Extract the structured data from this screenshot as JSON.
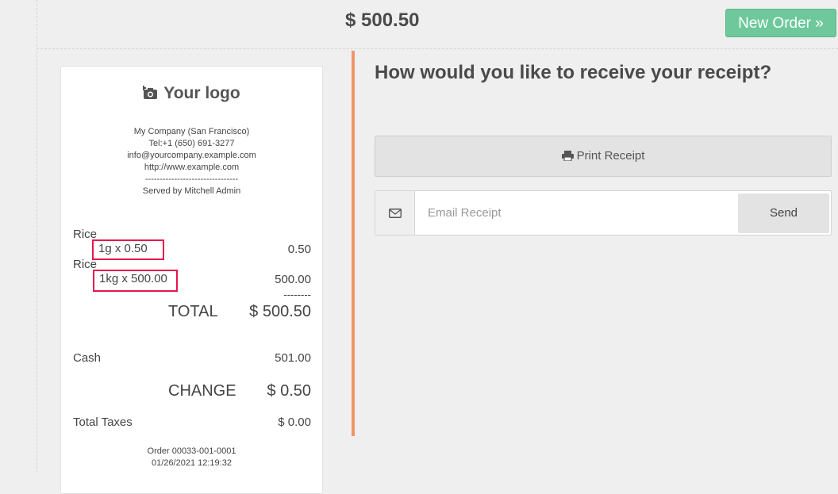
{
  "header": {
    "total": "$ 500.50",
    "new_order_label": "New Order",
    "new_order_icon": "double-chevron-right-icon"
  },
  "receipt": {
    "logo_text": "Your logo",
    "company_lines": [
      "My Company (San Francisco)",
      "Tel:+1 (650) 691-3277",
      "info@yourcompany.example.com",
      "http://www.example.com",
      "--------------------------------",
      "Served by Mitchell Admin"
    ],
    "lines": [
      {
        "product": "Rice",
        "qty": "1g x 0.50",
        "amount": "0.50"
      },
      {
        "product": "Rice",
        "qty": "1kg x 500.00",
        "amount": "500.00"
      }
    ],
    "separator": "--------",
    "total_label": "TOTAL",
    "total_amount": "$ 500.50",
    "payment_label": "Cash",
    "payment_amount": "501.00",
    "change_label": "CHANGE",
    "change_amount": "$ 0.50",
    "taxes_label": "Total Taxes",
    "taxes_amount": "$ 0.00",
    "order_ref": "Order 00033-001-0001",
    "order_date": "01/26/2021 12:19:32"
  },
  "panel": {
    "question": "How would you like to receive your receipt?",
    "print_label": "Print Receipt",
    "print_icon": "printer-icon",
    "email_icon": "envelope-icon",
    "email_placeholder": "Email Receipt",
    "send_label": "Send"
  },
  "colors": {
    "accent_bar": "#f0956a",
    "new_order_bg": "#6ec89b",
    "highlight_border": "#e8144d"
  }
}
